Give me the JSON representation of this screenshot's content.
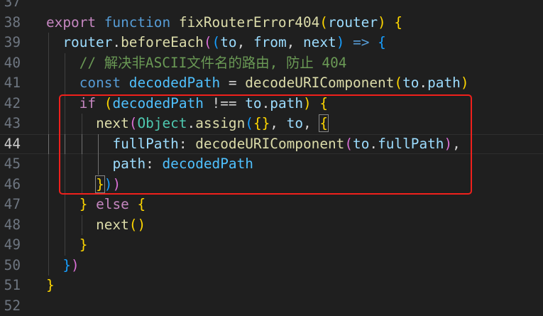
{
  "colors": {
    "kw": "#c586c0",
    "st": "#569cd6",
    "fn": "#dcdcaa",
    "var": "#9cdcfe",
    "cst": "#4fc1ff",
    "cm": "#6a9955",
    "cls": "#4ec9b0",
    "p": "#d4d4d4",
    "b1": "#ffd700",
    "b2": "#da70d6",
    "b3": "#179fff",
    "num": "#b5cea8"
  },
  "lines": [
    {
      "n": "37",
      "indent": 0,
      "tokens": []
    },
    {
      "n": "38",
      "indent": 0,
      "tokens": [
        [
          "export",
          "kw"
        ],
        [
          " ",
          "p"
        ],
        [
          "function",
          "st"
        ],
        [
          " ",
          "p"
        ],
        [
          "fixRouterError404",
          "fn"
        ],
        [
          "(",
          "b1"
        ],
        [
          "router",
          "var"
        ],
        [
          ")",
          "b1"
        ],
        [
          " ",
          "p"
        ],
        [
          "{",
          "b1"
        ]
      ]
    },
    {
      "n": "39",
      "indent": 1,
      "tokens": [
        [
          "router",
          "var"
        ],
        [
          ".",
          "p"
        ],
        [
          "beforeEach",
          "fn"
        ],
        [
          "(",
          "b2"
        ],
        [
          "(",
          "b3"
        ],
        [
          "to",
          "var"
        ],
        [
          ", ",
          "p"
        ],
        [
          "from",
          "var"
        ],
        [
          ", ",
          "p"
        ],
        [
          "next",
          "var"
        ],
        [
          ")",
          "b3"
        ],
        [
          " ",
          "p"
        ],
        [
          "=>",
          "st"
        ],
        [
          " ",
          "p"
        ],
        [
          "{",
          "b3"
        ]
      ]
    },
    {
      "n": "40",
      "indent": 2,
      "tokens": [
        [
          "// 解决非ASCII文件名的路由, 防止 404",
          "cm"
        ]
      ]
    },
    {
      "n": "41",
      "indent": 2,
      "tokens": [
        [
          "const",
          "st"
        ],
        [
          " ",
          "p"
        ],
        [
          "decodedPath",
          "cst"
        ],
        [
          " = ",
          "p"
        ],
        [
          "decodeURIComponent",
          "fn"
        ],
        [
          "(",
          "b1"
        ],
        [
          "to",
          "var"
        ],
        [
          ".",
          "p"
        ],
        [
          "path",
          "var"
        ],
        [
          ")",
          "b1"
        ]
      ]
    },
    {
      "n": "42",
      "indent": 2,
      "tokens": [
        [
          "if",
          "kw"
        ],
        [
          " ",
          "p"
        ],
        [
          "(",
          "b1"
        ],
        [
          "decodedPath",
          "cst"
        ],
        [
          " !== ",
          "p"
        ],
        [
          "to",
          "var"
        ],
        [
          ".",
          "p"
        ],
        [
          "path",
          "var"
        ],
        [
          ")",
          "b1"
        ],
        [
          " ",
          "p"
        ],
        [
          "{",
          "b1"
        ]
      ]
    },
    {
      "n": "43",
      "indent": 3,
      "tokens": [
        [
          "next",
          "fn"
        ],
        [
          "(",
          "b2"
        ],
        [
          "Object",
          "cls"
        ],
        [
          ".",
          "p"
        ],
        [
          "assign",
          "fn"
        ],
        [
          "(",
          "b3"
        ],
        [
          "{}",
          "b1"
        ],
        [
          ", ",
          "p"
        ],
        [
          "to",
          "var"
        ],
        [
          ", ",
          "p"
        ],
        [
          "{",
          "b1",
          "box"
        ]
      ]
    },
    {
      "n": "44",
      "indent": 4,
      "active": true,
      "tokens": [
        [
          "fullPath",
          "var"
        ],
        [
          ": ",
          "p"
        ],
        [
          "decodeURIComponent",
          "fn"
        ],
        [
          "(",
          "b2"
        ],
        [
          "to",
          "var"
        ],
        [
          ".",
          "p"
        ],
        [
          "fullPath",
          "var"
        ],
        [
          ")",
          "b2"
        ],
        [
          ",",
          "p"
        ]
      ]
    },
    {
      "n": "45",
      "indent": 4,
      "tokens": [
        [
          "path",
          "var"
        ],
        [
          ": ",
          "p"
        ],
        [
          "decodedPath",
          "cst"
        ]
      ]
    },
    {
      "n": "46",
      "indent": 3,
      "tokens": [
        [
          "}",
          "b1",
          "box"
        ],
        [
          ")",
          "b3"
        ],
        [
          ")",
          "b2"
        ]
      ]
    },
    {
      "n": "47",
      "indent": 2,
      "tokens": [
        [
          "}",
          "b1"
        ],
        [
          " ",
          "p"
        ],
        [
          "else",
          "kw"
        ],
        [
          " ",
          "p"
        ],
        [
          "{",
          "b1"
        ]
      ]
    },
    {
      "n": "48",
      "indent": 3,
      "tokens": [
        [
          "next",
          "fn"
        ],
        [
          "()",
          "b1"
        ]
      ]
    },
    {
      "n": "49",
      "indent": 2,
      "tokens": [
        [
          "}",
          "b1"
        ]
      ]
    },
    {
      "n": "50",
      "indent": 1,
      "tokens": [
        [
          "}",
          "b3"
        ],
        [
          ")",
          "b2"
        ]
      ]
    },
    {
      "n": "51",
      "indent": 0,
      "tokens": [
        [
          "}",
          "b1"
        ]
      ]
    },
    {
      "n": "52",
      "indent": 0,
      "tokens": []
    }
  ]
}
